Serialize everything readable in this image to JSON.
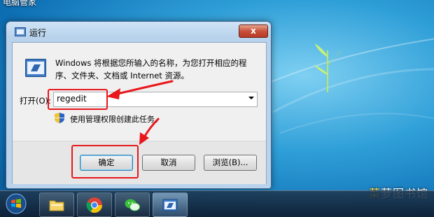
{
  "desktop": {
    "label": "电脑管家"
  },
  "watermark": {
    "prefix": "菜",
    "rest": "萝图书馆"
  },
  "dialog": {
    "title": "运行",
    "close_label": "x",
    "description": "Windows 将根据您所输入的名称，为您打开相应的程序、文件夹、文档或 Internet 资源。",
    "open_label": "打开(O):",
    "input_value": "regedit",
    "admin_note": "使用管理权限创建此任务。",
    "buttons": {
      "ok": "确定",
      "cancel": "取消",
      "browse": "浏览(B)..."
    }
  },
  "taskbar": {
    "items": [
      "file-explorer",
      "chrome",
      "wechat",
      "run-dialog"
    ]
  },
  "colors": {
    "annotation": "#e8171c",
    "accent": "#3c7fb1"
  }
}
